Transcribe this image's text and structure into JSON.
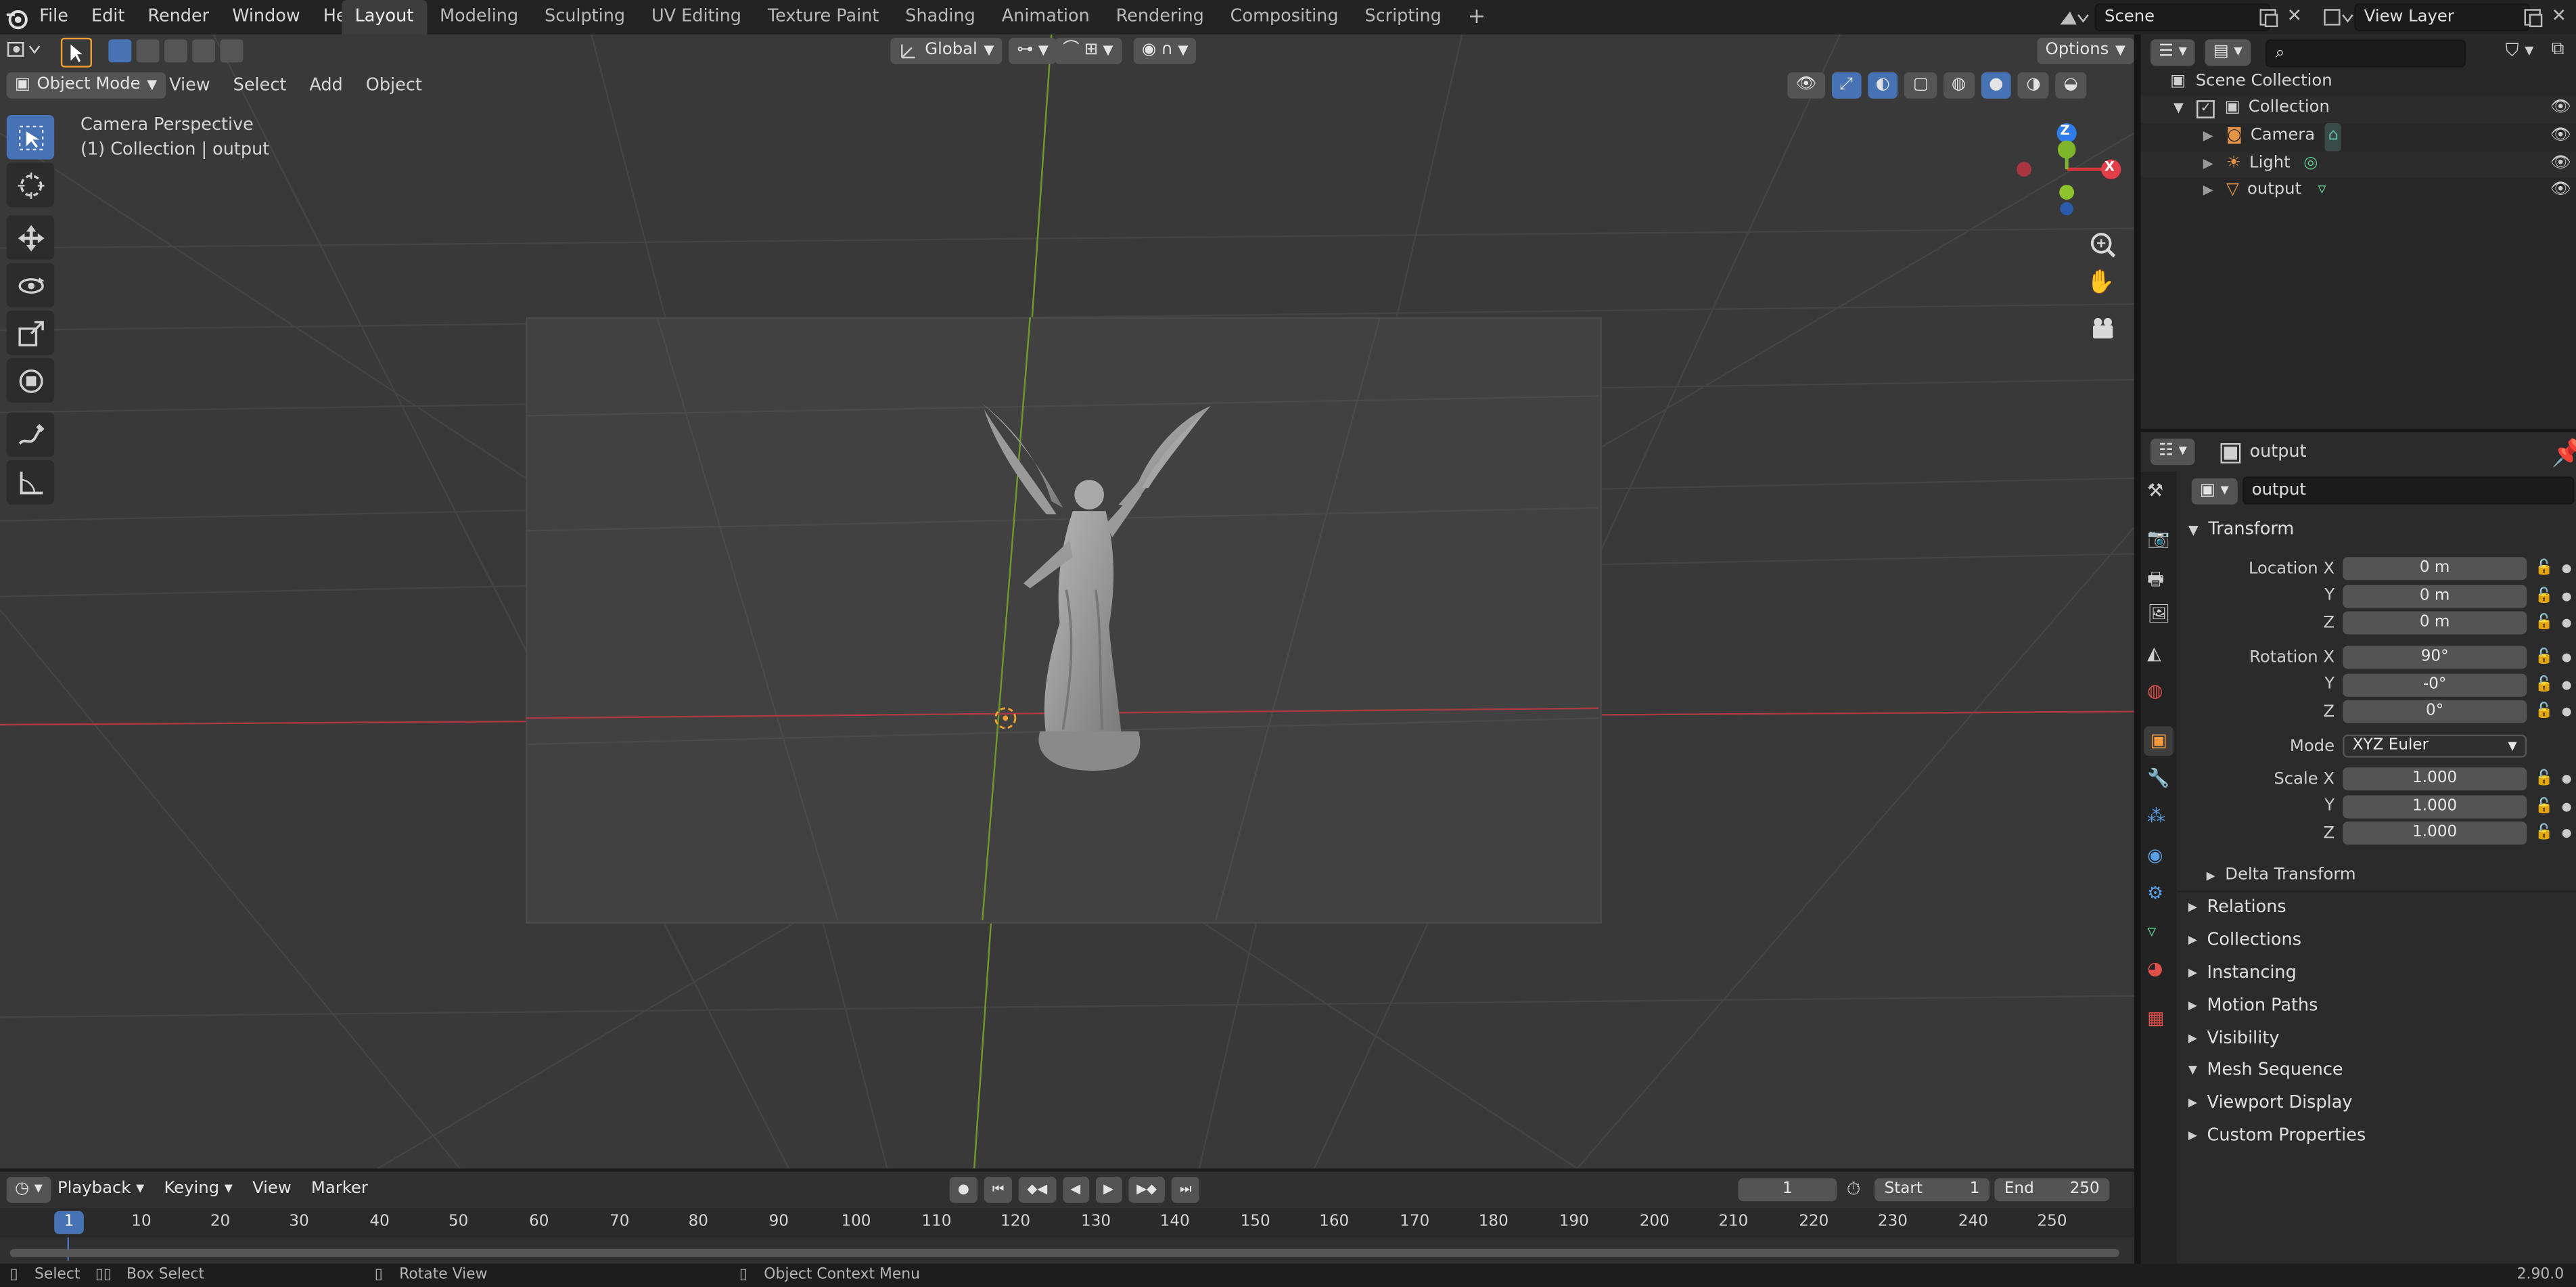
{
  "topbar": {
    "menus": [
      "File",
      "Edit",
      "Render",
      "Window",
      "Help"
    ],
    "workspaces": [
      "Layout",
      "Modeling",
      "Sculpting",
      "UV Editing",
      "Texture Paint",
      "Shading",
      "Animation",
      "Rendering",
      "Compositing",
      "Scripting"
    ],
    "active_workspace": "Layout",
    "add_symbol": "+",
    "scene": "Scene",
    "view_layer": "View Layer"
  },
  "viewport": {
    "mode": "Object Mode",
    "menus": [
      "View",
      "Select",
      "Add",
      "Object"
    ],
    "orientation": "Global",
    "options": "Options",
    "overlay_line1": "Camera Perspective",
    "overlay_line2": "(1) Collection | output",
    "gizmo": {
      "x": "X",
      "y": "Y",
      "z": "Z"
    }
  },
  "outliner": {
    "search_placeholder": "",
    "root": "Scene Collection",
    "collection": "Collection",
    "items": [
      "Camera",
      "Light",
      "output"
    ]
  },
  "properties": {
    "header_object": "output",
    "object_name": "output",
    "transform_title": "Transform",
    "location": {
      "label": "Location X",
      "x": "0 m",
      "y": "0 m",
      "z": "0 m"
    },
    "rotation": {
      "label": "Rotation X",
      "x": "90°",
      "y": "-0°",
      "z": "0°"
    },
    "mode_label": "Mode",
    "mode_value": "XYZ Euler",
    "scale": {
      "label": "Scale X",
      "x": "1.000",
      "y": "1.000",
      "z": "1.000"
    },
    "axis_y": "Y",
    "axis_z": "Z",
    "delta_transform": "Delta Transform",
    "panels": [
      "Relations",
      "Collections",
      "Instancing",
      "Motion Paths",
      "Visibility",
      "Mesh Sequence",
      "Viewport Display",
      "Custom Properties"
    ]
  },
  "timeline": {
    "menus": [
      "Playback",
      "Keying",
      "View",
      "Marker"
    ],
    "current_frame": "1",
    "start_label": "Start",
    "start_value": "1",
    "end_label": "End",
    "end_value": "250",
    "ruler_marks": [
      "10",
      "20",
      "30",
      "40",
      "50",
      "60",
      "70",
      "80",
      "90",
      "100",
      "110",
      "120",
      "130",
      "140",
      "150",
      "160",
      "170",
      "180",
      "190",
      "200",
      "210",
      "220",
      "230",
      "240",
      "250"
    ],
    "playhead": "1"
  },
  "statusbar": {
    "select": "Select",
    "box_select": "Box Select",
    "rotate_view": "Rotate View",
    "context_menu": "Object Context Menu",
    "version": "2.90.0"
  }
}
